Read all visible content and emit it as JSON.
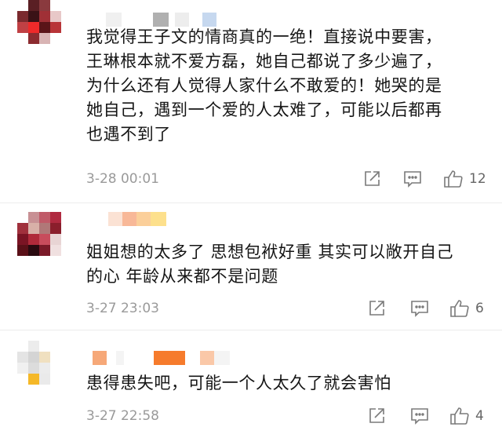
{
  "comments": [
    {
      "text_lines": [
        "我觉得王子文的情商真的一绝！直接说中要害，",
        "王琳根本就不爱方磊，她自己都说了多少遍了，",
        "为什么还有人觉得人家什么不敢爱的！她哭的是",
        "她自己，遇到一个爱的人太难了，可能以后都再",
        "也遇不到了"
      ],
      "time": "3-28 00:01",
      "likes": "12"
    },
    {
      "text_lines": [
        "姐姐想的太多了 思想包袱好重 其实可以敞开自己",
        "的心 年龄从来都不是问题"
      ],
      "time": "3-27 23:03",
      "likes": "6"
    },
    {
      "text_lines": [
        "患得患失吧，可能一个人太久了就会害怕"
      ],
      "time": "3-27 22:58",
      "likes": "4"
    }
  ],
  "icons": {
    "share": "share-icon",
    "reply": "comment-icon",
    "like": "thumbs-up-icon"
  },
  "colors": {
    "meta_text": "#9a9a9a",
    "icon_stroke": "#7a7a7a"
  }
}
